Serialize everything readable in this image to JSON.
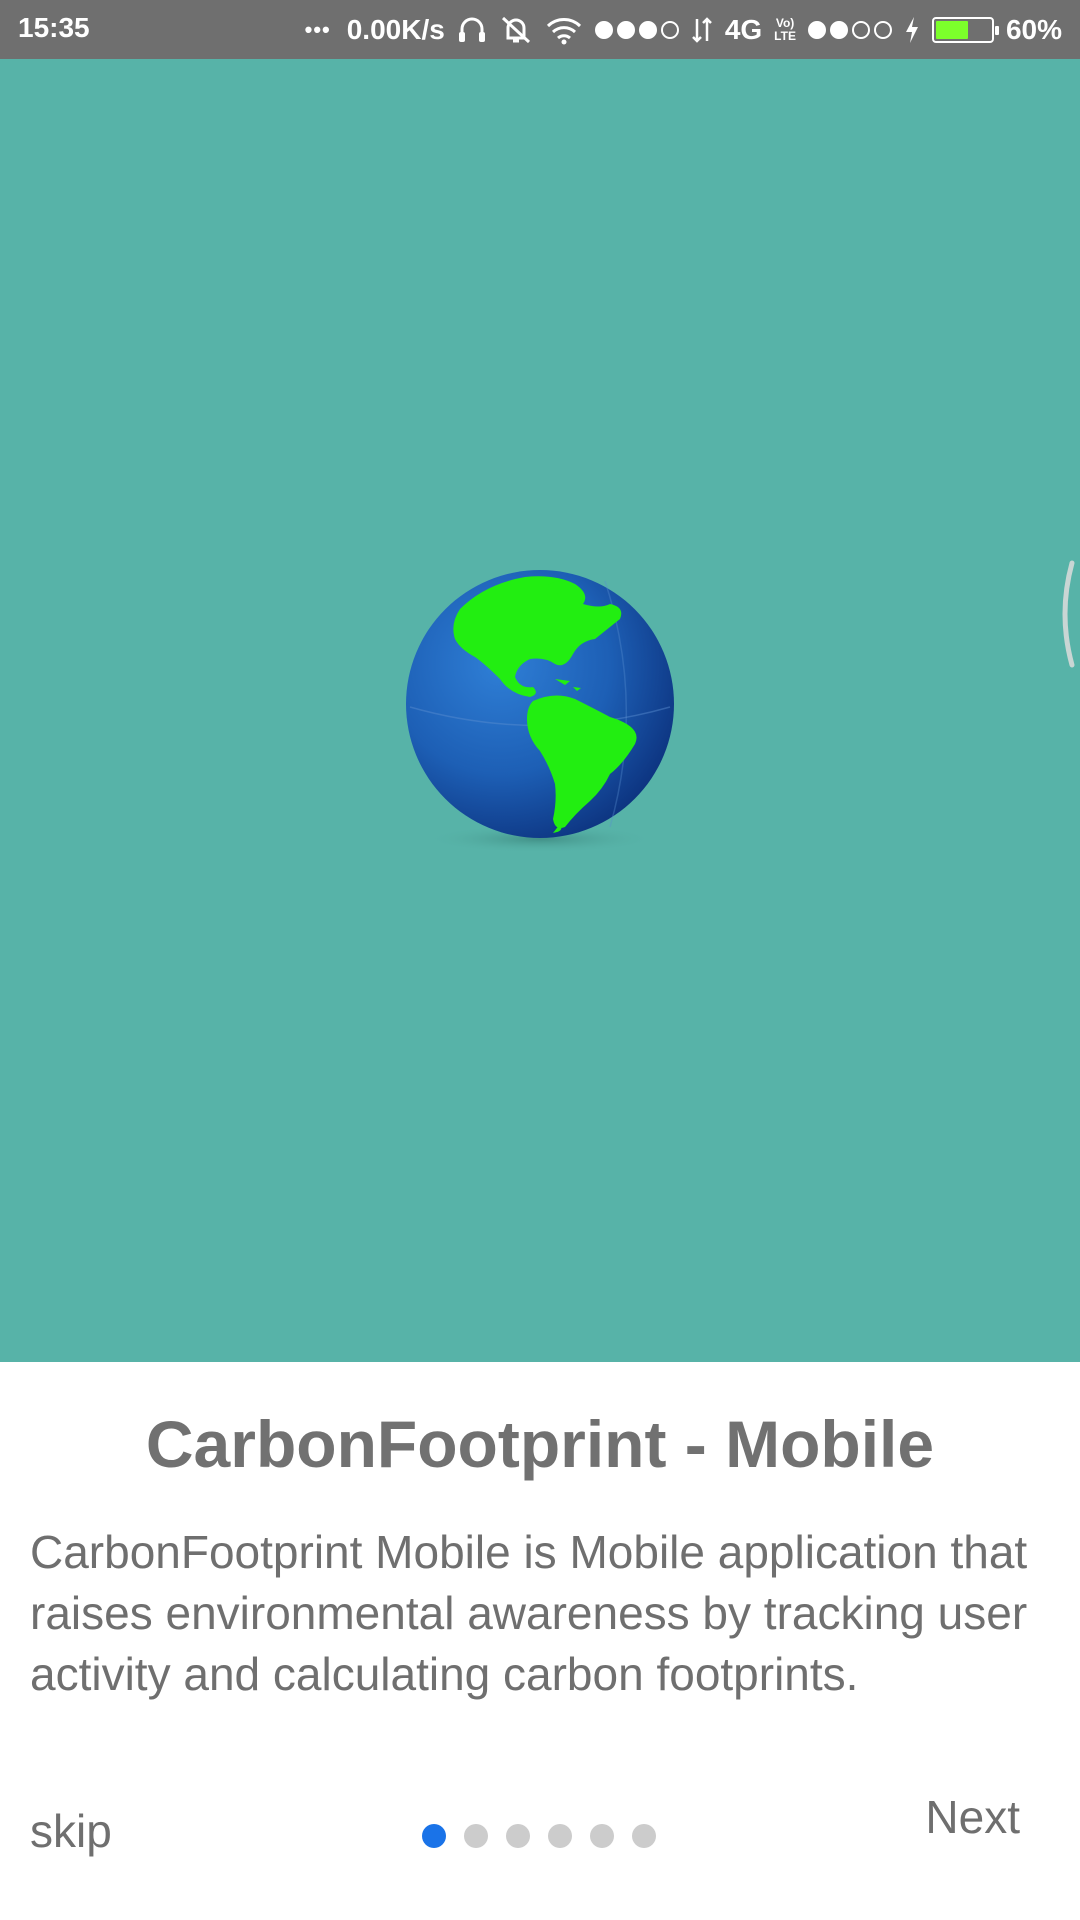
{
  "status_bar": {
    "time": "15:35",
    "menu_dots": "•••",
    "net_speed": "0.00K/s",
    "network_type": "4G",
    "volte_top": "Vo)",
    "volte_bottom": "LTE",
    "battery_percent": "60%",
    "battery_level": 0.6,
    "icons": [
      "headphones-icon",
      "mute-icon",
      "wifi-icon",
      "signal-dots-icon",
      "data-arrows-icon",
      "volte-icon",
      "signal-dots-icon",
      "charging-icon",
      "battery-icon"
    ],
    "battery_color": "#7cff2b"
  },
  "hero": {
    "background": "#57b3a8",
    "image": "globe-icon"
  },
  "intro": {
    "title": "CarbonFootprint - Mobile",
    "description": "CarbonFootprint Mobile is Mobile application that raises environmental awareness by tracking user activity and calculating carbon footprints.",
    "skip_label": "skip",
    "next_label": "Next",
    "page_count": 6,
    "current_page": 1,
    "active_dot_color": "#1a73e8",
    "inactive_dot_color": "#cccccc"
  }
}
